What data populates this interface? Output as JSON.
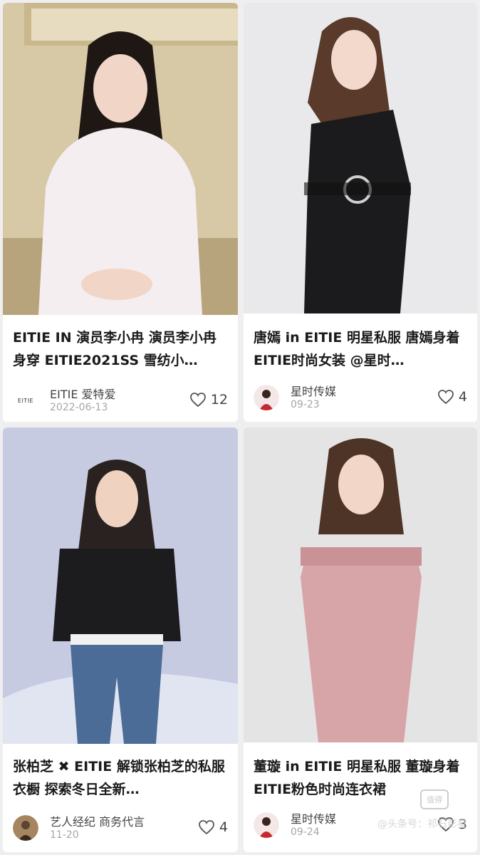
{
  "posts": [
    {
      "title": "EITIE IN 演员李小冉 演员李小冉身穿 EITIE2021SS 雪纺小…",
      "author": "EITIE 爱特爱",
      "avatar_text": "EITIE",
      "date": "2022-06-13",
      "likes": "12",
      "photo_bg": "#d8c9a6",
      "dress_color": "#f5eef0"
    },
    {
      "title": "唐嫣 in EITIE 明星私服 唐嫣身着 EITIE时尚女装 @星时…",
      "author": "星时传媒",
      "date": "09-23",
      "likes": "4",
      "photo_bg": "#e9e8ea",
      "dress_color": "#1b1b1d"
    },
    {
      "title": "张柏芝 ✖ EITIE 解锁张柏芝的私服衣橱 探索冬日全新…",
      "author": "艺人经纪 商务代言",
      "date": "11-20",
      "likes": "4",
      "photo_bg": "#c7cbe2",
      "dress_color": "#1c1c1f"
    },
    {
      "title": "董璇 in EITIE 明星私服 董璇身着 EITIE粉色时尚连衣裙",
      "author": "星时传媒",
      "date": "09-24",
      "likes": "3",
      "photo_bg": "#e4e4e4",
      "dress_color": "#d7a5a8"
    }
  ],
  "watermark": {
    "badge": "值得",
    "text": "@头条号：祁石彭星"
  }
}
